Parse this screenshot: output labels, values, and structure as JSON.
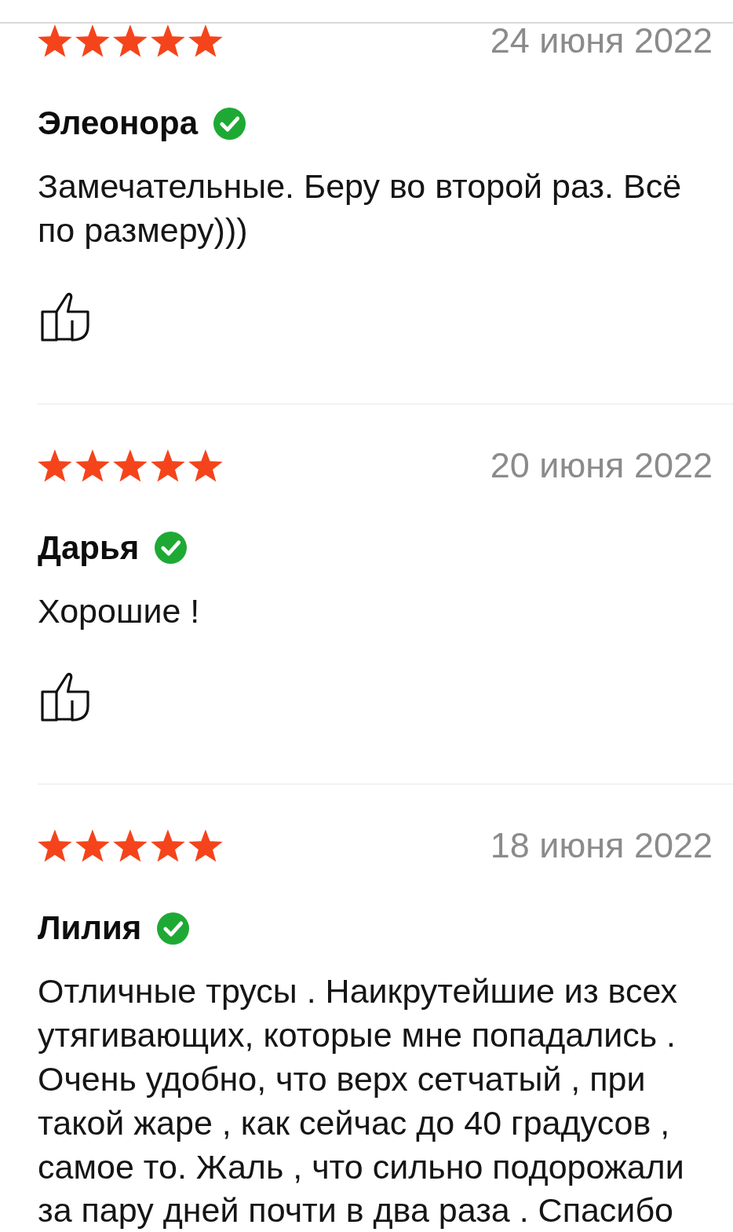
{
  "reviews": [
    {
      "stars": 5,
      "date": "24 июня 2022",
      "author": "Элеонора",
      "verified": true,
      "text": "Замечательные. Беру во второй раз. Всё по размеру)))",
      "like_button": {
        "selected": false
      }
    },
    {
      "stars": 5,
      "date": "20 июня 2022",
      "author": "Дарья",
      "verified": true,
      "text": "Хорошие !",
      "like_button": {
        "selected": false
      }
    },
    {
      "stars": 5,
      "date": "18 июня 2022",
      "author": "Лилия",
      "verified": true,
      "text": "Отличные трусы . Наикрутейшие из всех утягивающих, которые мне попадались . Очень удобно, что верх сетчатый , при такой жаре , как сейчас до 40 градусов , самое то. Жаль , что сильно подорожали за пару дней почти в два раза . Спасибо"
    }
  ]
}
